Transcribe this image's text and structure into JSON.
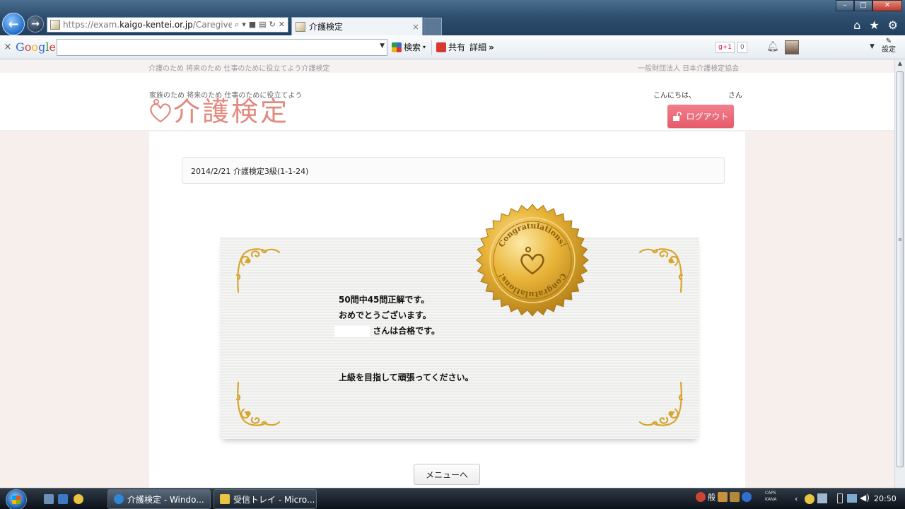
{
  "browser": {
    "url_prefix": "https://exam.",
    "url_domain": "kaigo-kentei.or.jp",
    "url_path": "/Caregive",
    "tab_title": "介護検定",
    "tab_close": "×"
  },
  "google_toolbar": {
    "close": "×",
    "search_label": "検索",
    "share_label": "共有",
    "more_label": "詳細",
    "more_chevron": "»",
    "gplus_label": "g+1",
    "gplus_count": "0",
    "settings_label": "設定"
  },
  "site": {
    "tagline_top": "介護のため 将来のため 仕事のために役立てよう介護検定",
    "org_name": "一般財団法人 日本介護検定協会",
    "tagline": "家族のため 将来のため 仕事のために役立てよう",
    "logo_text": "介護検定",
    "greeting_prefix": "こんにちは、",
    "greeting_suffix": "さん",
    "logout_label": "ログアウト"
  },
  "exam": {
    "title": "2014/2/21 介護検定3級(1-1-24)"
  },
  "certificate": {
    "seal_text": "Congratulations!",
    "line1": "50問中45問正解です。",
    "line2": "おめでとうございます。",
    "line3": "さんは合格です。",
    "line4": "上級を目指して頑張ってください。"
  },
  "menu_button": "メニューへ",
  "taskbar": {
    "task1": "介護検定 - Windo...",
    "task2": "受信トレイ - Micro...",
    "tray_general": "般",
    "caps_line1": "CAPS",
    "caps_line2": "KANA",
    "clock": "20:50"
  },
  "colors": {
    "brand_pink": "#e28a80",
    "logout_bg": "#e65b6b",
    "gold": "#d9a430"
  }
}
